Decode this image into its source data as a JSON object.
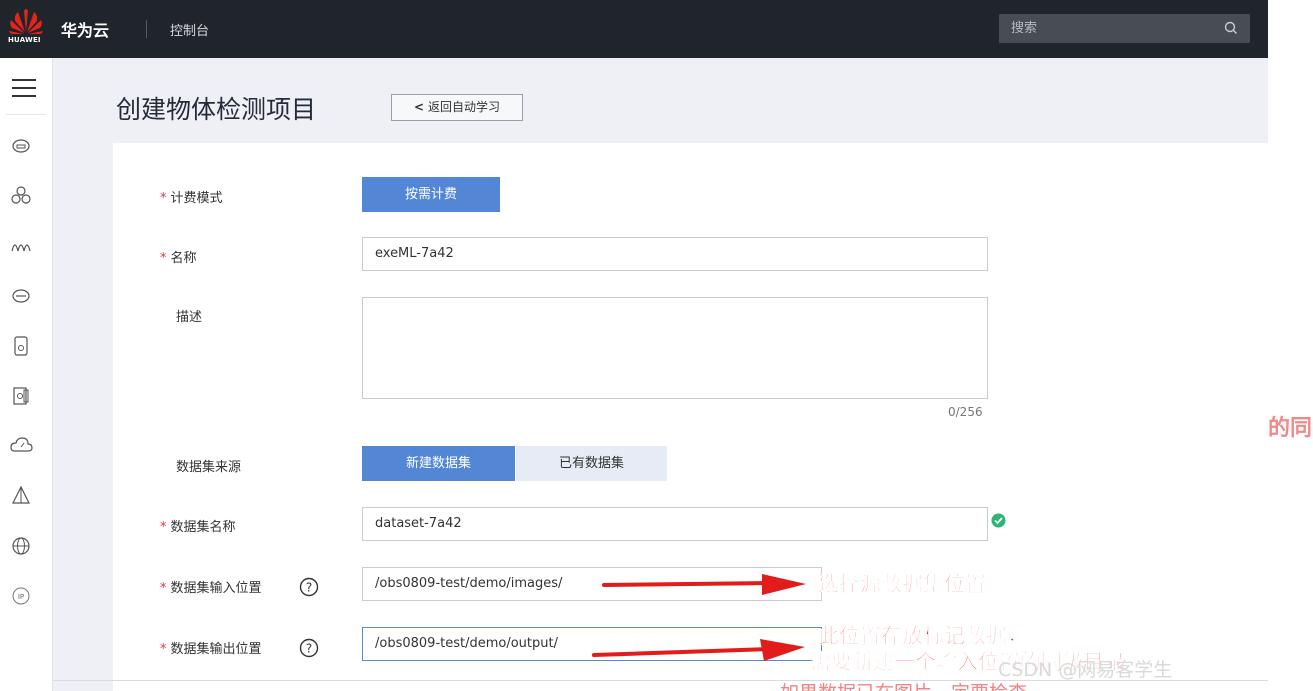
{
  "topbar": {
    "logo_text": "HUAWEI",
    "brand": "华为云",
    "console": "控制台",
    "search_placeholder": "搜索"
  },
  "sidebar": {
    "icons": [
      "menu-icon",
      "cloud-server-icon",
      "cluster-icon",
      "signal-icon",
      "storage-icon",
      "container-icon",
      "backup-icon",
      "cloud-gauge-icon",
      "tent-icon",
      "globe-icon",
      "ip-icon"
    ]
  },
  "page": {
    "title": "创建物体检测项目",
    "back_label": "返回自动学习"
  },
  "form": {
    "billing_label": "计费模式",
    "billing_value": "按需计费",
    "name_label": "名称",
    "name_value": "exeML-7a42",
    "desc_label": "描述",
    "desc_counter": "0/256",
    "source_label": "数据集来源",
    "source_new": "新建数据集",
    "source_existing": "已有数据集",
    "dataset_name_label": "数据集名称",
    "dataset_name_value": "dataset-7a42",
    "input_loc_label": "数据集输入位置",
    "input_loc_value": "/obs0809-test/demo/images/",
    "output_loc_label": "数据集输出位置",
    "output_loc_value": "/obs0809-test/demo/output/"
  },
  "annotations": {
    "input_note": "选择源数据集位置",
    "output_note_line1": "此位置存放标记数据，",
    "output_note_line2": "需要新建一个输入位置的同级目录",
    "bottom_note": "如果数据已在图片一定要检查",
    "right_peek": "的同"
  },
  "watermark": "CSDN @网易客学生",
  "colors": {
    "topbar": "#20242b",
    "primary": "#5387d6",
    "required_star": "#e6313a",
    "annotation": "#ee1c1c",
    "success": "#2bb673"
  }
}
